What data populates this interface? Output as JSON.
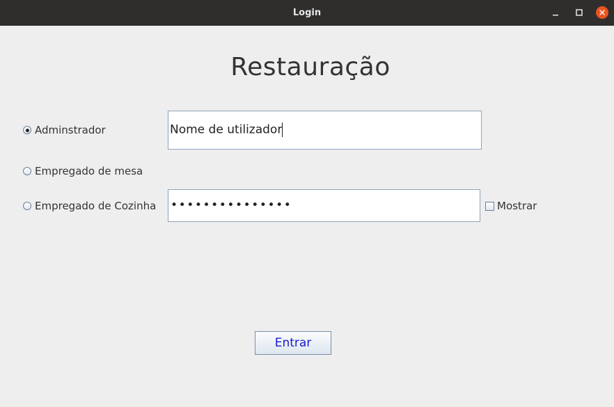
{
  "window": {
    "title": "Login",
    "controls": {
      "minimize_icon": "minimize-icon",
      "maximize_icon": "maximize-icon",
      "close_icon": "close-icon",
      "close_color": "#e95420"
    }
  },
  "main": {
    "heading": "Restauração",
    "roles": [
      {
        "label": "Adminstrador",
        "selected": true
      },
      {
        "label": "Empregado de mesa",
        "selected": false
      },
      {
        "label": "Empregado de Cozinha",
        "selected": false
      }
    ],
    "username": {
      "value": "Nome de utilizador"
    },
    "password": {
      "masked_value": "•••••••••••••••"
    },
    "show_password": {
      "label": "Mostrar",
      "checked": false
    },
    "submit_label": "Entrar"
  },
  "colors": {
    "titlebar": "#2f2e2d",
    "background": "#eeeeee",
    "button_text": "#1a1acc"
  }
}
